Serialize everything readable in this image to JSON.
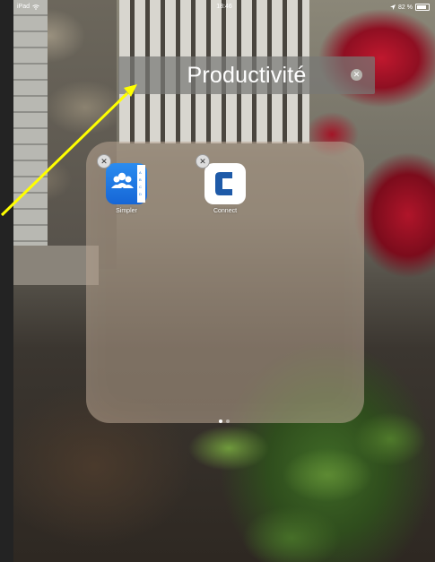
{
  "status_bar": {
    "device": "iPad",
    "time": "18:46",
    "battery_text": "82 %",
    "battery_level": 0.82
  },
  "folder": {
    "title": "Productivité"
  },
  "apps": [
    {
      "name": "Simpler",
      "icon": "contacts-people-icon",
      "icon_color": "#1b7be6"
    },
    {
      "name": "Connect",
      "icon": "letter-c-icon",
      "icon_color": "#1e5aa8"
    }
  ],
  "pagination": {
    "pages": 2,
    "current": 1
  },
  "colors": {
    "annotation_arrow": "#ffff00"
  }
}
